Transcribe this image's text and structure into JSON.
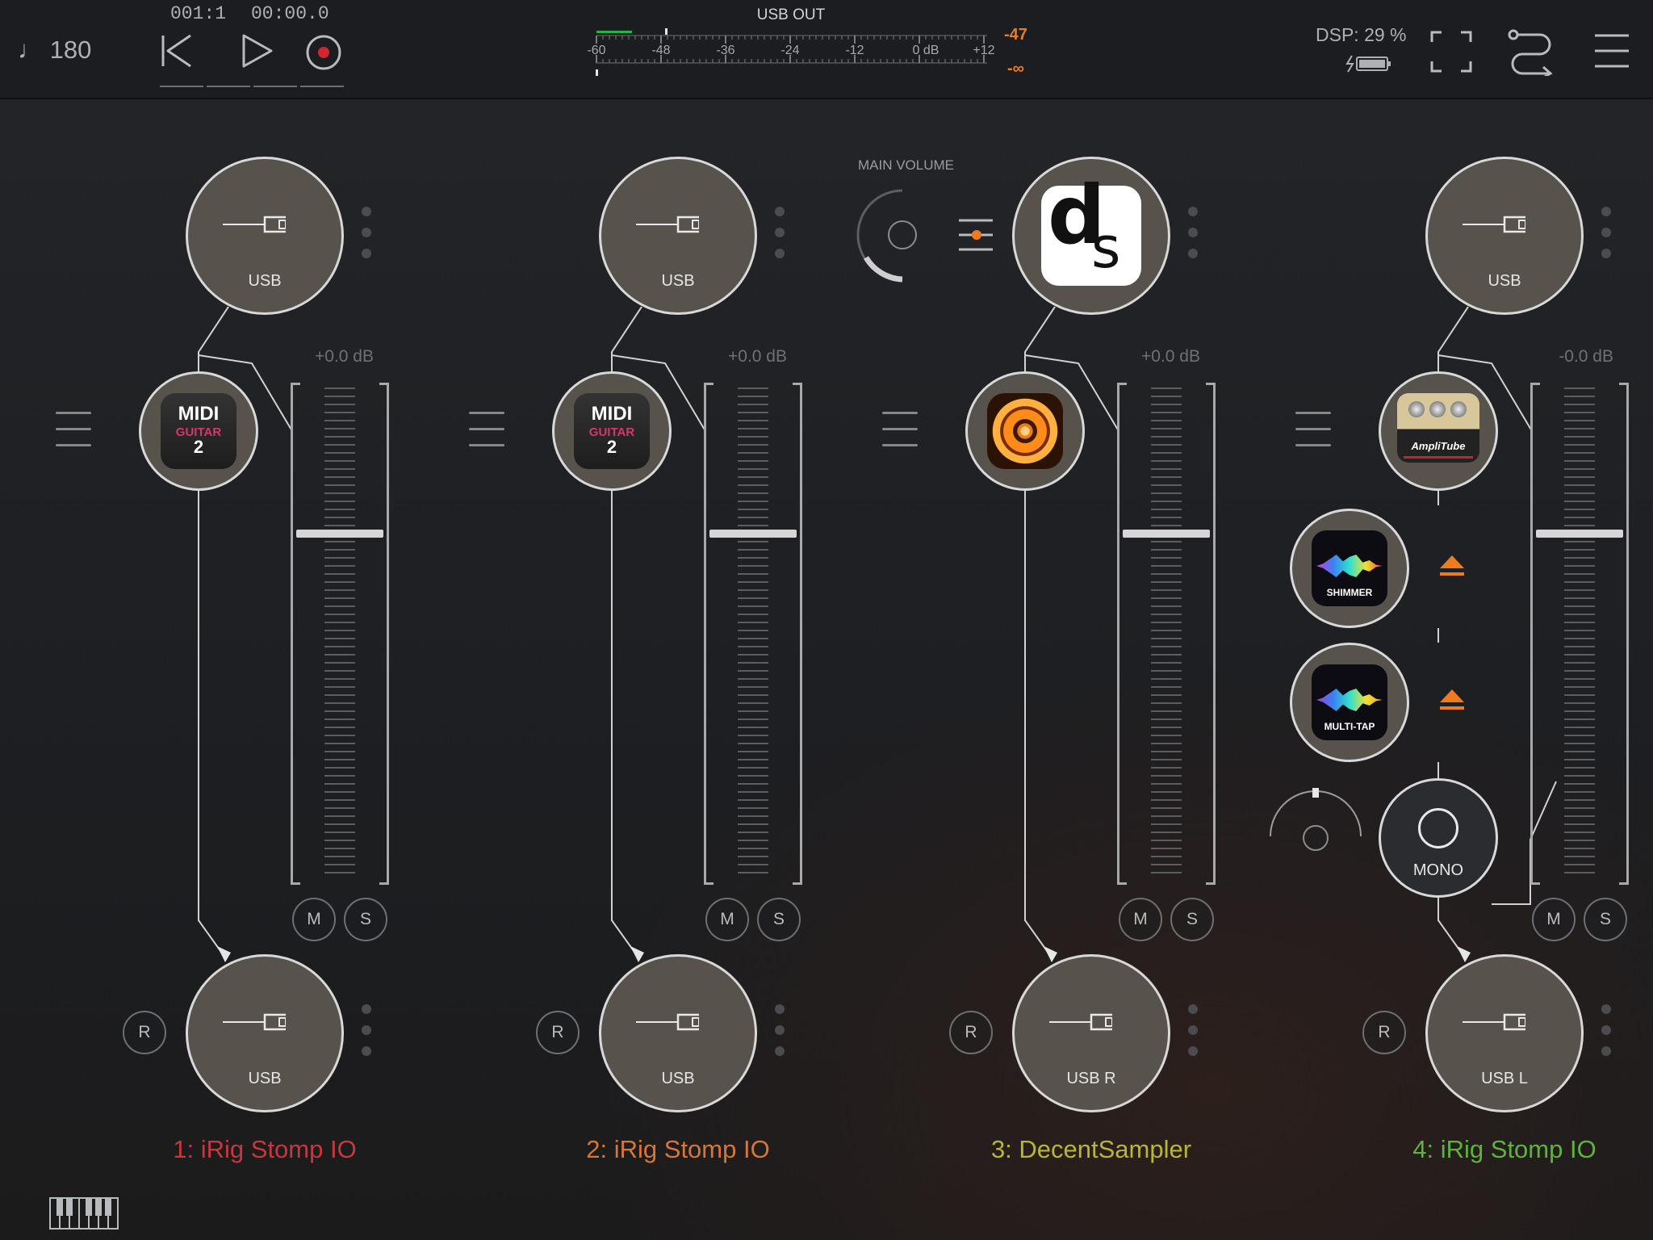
{
  "topbar": {
    "tempo": "♩ 180",
    "position_bars": "001:1",
    "position_time": "00:00.0",
    "meter_title": "USB OUT",
    "meter_scale": [
      "-60",
      "-48",
      "-36",
      "-24",
      "-12",
      "0 dB",
      "+12"
    ],
    "meter_peak": "-47",
    "meter_rms": "-∞",
    "dsp": "DSP: 29 %",
    "accent_color": "#f07a1e"
  },
  "main_volume": {
    "label": "MAIN VOLUME"
  },
  "channels": [
    {
      "name": "1: iRig Stomp IO",
      "color": "#c8373d",
      "input_label": "USB",
      "output_label": "USB",
      "gain": "+0.0 dB",
      "plugin": "MIDI Guitar 2",
      "mute": "M",
      "solo": "S",
      "record": "R"
    },
    {
      "name": "2: iRig Stomp IO",
      "color": "#d8763a",
      "input_label": "USB",
      "output_label": "USB",
      "gain": "+0.0 dB",
      "plugin": "MIDI Guitar 2",
      "mute": "M",
      "solo": "S",
      "record": "R"
    },
    {
      "name": "3: DecentSampler",
      "color": "#b9b43a",
      "input_label": "ds",
      "output_label": "USB R",
      "gain": "+0.0 dB",
      "plugin": "Orange disc instrument",
      "mute": "M",
      "solo": "S",
      "record": "R"
    },
    {
      "name": "4: iRig Stomp IO",
      "color": "#5db43a",
      "input_label": "USB",
      "output_label": "USB L",
      "gain": "-0.0 dB",
      "plugin": "AmpliTube",
      "mute": "M",
      "solo": "S",
      "record": "R",
      "effects": [
        "SHIMMER",
        "MULTI-TAP"
      ],
      "mono_label": "MONO"
    }
  ],
  "plugin_text": {
    "midi_line1": "MIDI",
    "midi_line2": "GUITAR",
    "midi_line3": "2",
    "amp_brand": "AmpliTube",
    "ds_main": "d",
    "ds_sub": "s"
  }
}
